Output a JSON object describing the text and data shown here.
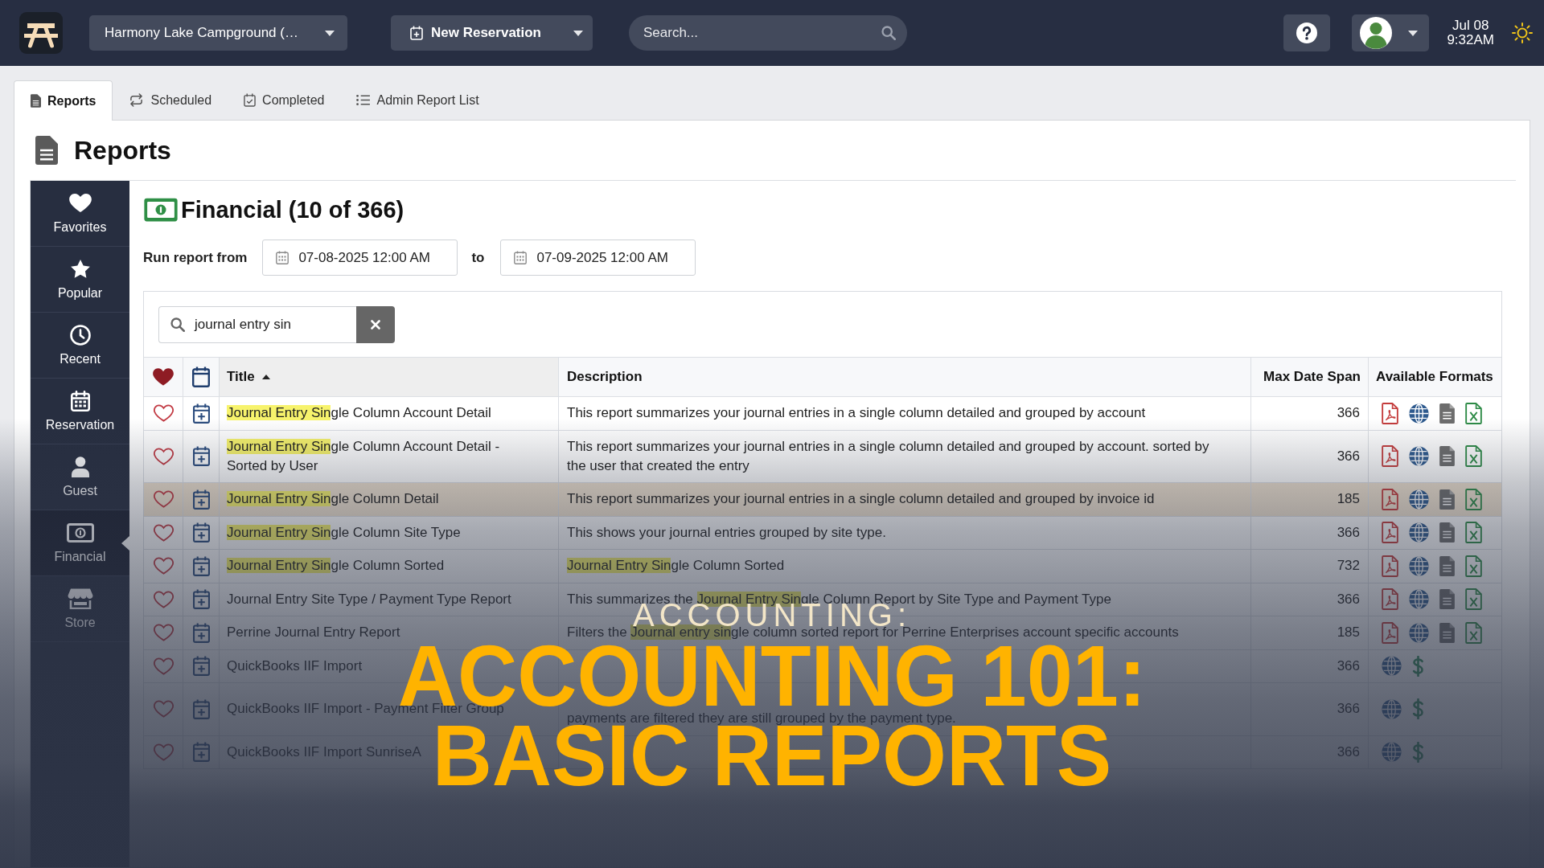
{
  "top_bar": {
    "location": "Harmony Lake Campground (…",
    "new_reservation": "New Reservation",
    "search": {
      "placeholder": "Search..."
    },
    "date": "Jul 08",
    "time": "9:32AM"
  },
  "tabs": [
    {
      "label": "Reports",
      "kind": "document",
      "selected": true
    },
    {
      "label": "Scheduled",
      "kind": "repeat",
      "selected": false
    },
    {
      "label": "Completed",
      "kind": "calendar-check",
      "selected": false
    },
    {
      "label": "Admin Report List",
      "kind": "list",
      "selected": false
    }
  ],
  "page_title": "Reports",
  "categories": [
    {
      "label": "Favorites",
      "kind": "heart",
      "selected": false
    },
    {
      "label": "Popular",
      "kind": "star",
      "selected": false
    },
    {
      "label": "Recent",
      "kind": "clock",
      "selected": false
    },
    {
      "label": "Reservation",
      "kind": "calendar",
      "selected": false
    },
    {
      "label": "Guest",
      "kind": "person",
      "selected": false
    },
    {
      "label": "Financial",
      "kind": "money",
      "selected": true
    },
    {
      "label": "Store",
      "kind": "store",
      "selected": false
    }
  ],
  "report_panel": {
    "title": "Financial (10 of 366)",
    "range_label": "Run report from",
    "from": "07-08-2025 12:00 AM",
    "to_label": "to",
    "to": "07-09-2025 12:00 AM",
    "filter": {
      "value": "journal entry sin"
    }
  },
  "table": {
    "columns": [
      {
        "label": "Title",
        "sorted": true
      },
      {
        "label": "Description",
        "sorted": false
      },
      {
        "label": "Max Date Span",
        "sorted": false
      },
      {
        "label": "Available Formats",
        "sorted": false
      }
    ],
    "rows": [
      {
        "title": [
          {
            "text": "Journal Entry Sin",
            "match": true
          },
          {
            "text": "gle Column Account Detail",
            "match": false
          }
        ],
        "description": [
          {
            "text": "This report summarizes your journal entries in a single column detailed and grouped by account",
            "match": false
          }
        ],
        "max_span": "366",
        "formats": [
          {
            "kind": "pdf"
          },
          {
            "kind": "web"
          },
          {
            "kind": "text"
          },
          {
            "kind": "excel"
          }
        ],
        "favorite": false,
        "highlighted": false
      },
      {
        "title": [
          {
            "text": "Journal Entry Sin",
            "match": true
          },
          {
            "text": "gle Column Account Detail - Sorted by User",
            "match": false
          }
        ],
        "description": [
          {
            "text": "This report summarizes your journal entries in a single column detailed and grouped by account. sorted by the user that created the entry",
            "match": false
          }
        ],
        "max_span": "366",
        "formats": [
          {
            "kind": "pdf"
          },
          {
            "kind": "web"
          },
          {
            "kind": "text"
          },
          {
            "kind": "excel"
          }
        ],
        "favorite": false,
        "highlighted": false
      },
      {
        "title": [
          {
            "text": "Journal Entry Sin",
            "match": true
          },
          {
            "text": "gle Column Detail",
            "match": false
          }
        ],
        "description": [
          {
            "text": "This report summarizes your journal entries in a single column detailed and grouped by invoice id",
            "match": false
          }
        ],
        "max_span": "185",
        "formats": [
          {
            "kind": "pdf"
          },
          {
            "kind": "web"
          },
          {
            "kind": "text"
          },
          {
            "kind": "excel"
          }
        ],
        "favorite": false,
        "highlighted": true
      },
      {
        "title": [
          {
            "text": "Journal Entry Sin",
            "match": true
          },
          {
            "text": "gle Column Site Type",
            "match": false
          }
        ],
        "description": [
          {
            "text": "This shows your journal entries grouped by site type.",
            "match": false
          }
        ],
        "max_span": "366",
        "formats": [
          {
            "kind": "pdf"
          },
          {
            "kind": "web"
          },
          {
            "kind": "text"
          },
          {
            "kind": "excel"
          }
        ],
        "favorite": false,
        "highlighted": false
      },
      {
        "title": [
          {
            "text": "Journal Entry Sin",
            "match": true
          },
          {
            "text": "gle Column Sorted",
            "match": false
          }
        ],
        "description": [
          {
            "text": "Journal Entry Sin",
            "match": true
          },
          {
            "text": "gle Column Sorted",
            "match": false
          }
        ],
        "max_span": "732",
        "formats": [
          {
            "kind": "pdf"
          },
          {
            "kind": "web"
          },
          {
            "kind": "text"
          },
          {
            "kind": "excel"
          }
        ],
        "favorite": false,
        "highlighted": false
      },
      {
        "title": [
          {
            "text": "Journal Entry Site Type / Payment Type Report",
            "match": false
          }
        ],
        "description": [
          {
            "text": "This summarizes the ",
            "match": false
          },
          {
            "text": "Journal Entry Sin",
            "match": true
          },
          {
            "text": "gle Column Report by Site Type and Payment Type",
            "match": false
          }
        ],
        "max_span": "366",
        "formats": [
          {
            "kind": "pdf"
          },
          {
            "kind": "web"
          },
          {
            "kind": "text"
          },
          {
            "kind": "excel"
          }
        ],
        "favorite": false,
        "highlighted": false
      },
      {
        "title": [
          {
            "text": "Perrine Journal Entry Report",
            "match": false
          }
        ],
        "description": [
          {
            "text": "Filters the ",
            "match": false
          },
          {
            "text": "Journal entry sin",
            "match": true
          },
          {
            "text": "gle column sorted report for Perrine Enterprises account specific accounts",
            "match": false
          }
        ],
        "max_span": "185",
        "formats": [
          {
            "kind": "pdf"
          },
          {
            "kind": "web"
          },
          {
            "kind": "text"
          },
          {
            "kind": "excel"
          }
        ],
        "favorite": false,
        "highlighted": false
      },
      {
        "title": [
          {
            "text": "QuickBooks IIF Import",
            "match": false
          }
        ],
        "max_span": "366",
        "formats": [
          {
            "kind": "web"
          },
          {
            "kind": "dollar"
          }
        ],
        "favorite": false,
        "highlighted": false
      },
      {
        "title": [
          {
            "text": "QuickBooks IIF Import - Payment Filter Group",
            "match": false
          }
        ],
        "description": [
          {
            "text": "payments are filtered they are still grouped by the payment type.",
            "match": false
          }
        ],
        "continued": true,
        "max_span": "366",
        "formats": [
          {
            "kind": "web"
          },
          {
            "kind": "dollar"
          }
        ],
        "favorite": false
      },
      {
        "title": [
          {
            "text": "QuickBooks IIF Import SunriseA",
            "match": false
          }
        ],
        "max_span": "366",
        "formats": [
          {
            "kind": "web"
          },
          {
            "kind": "dollar"
          }
        ],
        "favorite": false
      }
    ]
  },
  "overlay": {
    "kicker": "ACCOUNTING:",
    "headline": [
      "ACCOUNTING 101:",
      "BASIC REPORTS"
    ]
  }
}
